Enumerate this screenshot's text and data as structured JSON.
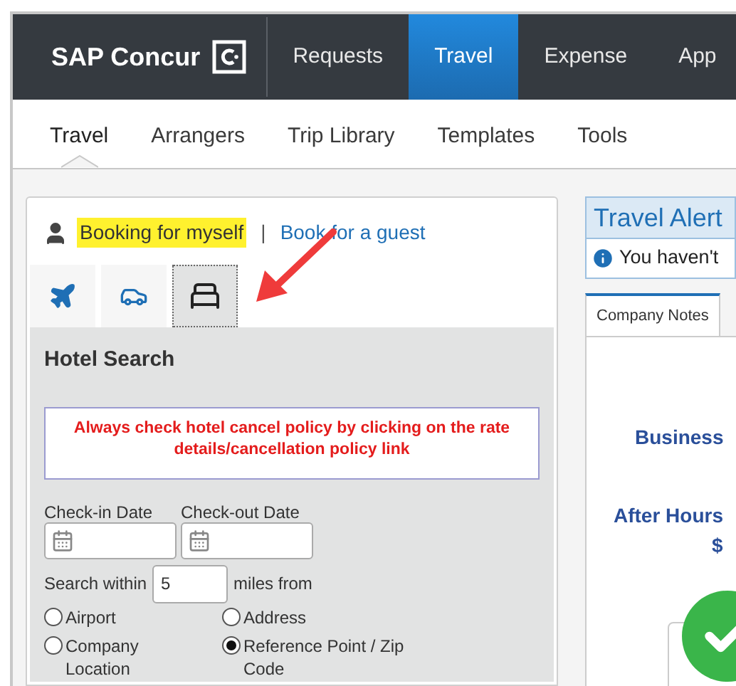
{
  "brand": {
    "name": "SAP Concur"
  },
  "top_nav": [
    {
      "label": "Requests",
      "selected": false
    },
    {
      "label": "Travel",
      "selected": true
    },
    {
      "label": "Expense",
      "selected": false
    },
    {
      "label": "App",
      "selected": false
    }
  ],
  "sub_nav": [
    {
      "label": "Travel",
      "selected": true
    },
    {
      "label": "Arrangers",
      "selected": false
    },
    {
      "label": "Trip Library",
      "selected": false
    },
    {
      "label": "Templates",
      "selected": false
    },
    {
      "label": "Tools",
      "selected": false
    }
  ],
  "booking": {
    "current": "Booking for myself",
    "separator": "|",
    "guest_link": "Book for a guest"
  },
  "search_tabs": [
    {
      "kind": "flight",
      "selected": false
    },
    {
      "kind": "car",
      "selected": false
    },
    {
      "kind": "hotel",
      "selected": true
    }
  ],
  "hotel_search": {
    "title": "Hotel Search",
    "notice": "Always check hotel cancel policy by clicking on the rate details/cancellation policy link",
    "check_in_label": "Check-in Date",
    "check_out_label": "Check-out Date",
    "search_within_label": "Search within",
    "radius": "5",
    "radius_unit": "miles from",
    "options": [
      {
        "label": "Airport",
        "selected": false
      },
      {
        "label": "Address",
        "selected": false
      },
      {
        "label": "Company Location",
        "selected": false
      },
      {
        "label": "Reference Point / Zip Code",
        "selected": true
      }
    ]
  },
  "travel_alert": {
    "title": "Travel Alert",
    "message": "You haven't"
  },
  "notes_tabs": [
    {
      "label": "Company Notes",
      "selected": true
    }
  ],
  "notes": {
    "line_1": "Business",
    "line_2": "After Hours",
    "line_3": "$"
  }
}
